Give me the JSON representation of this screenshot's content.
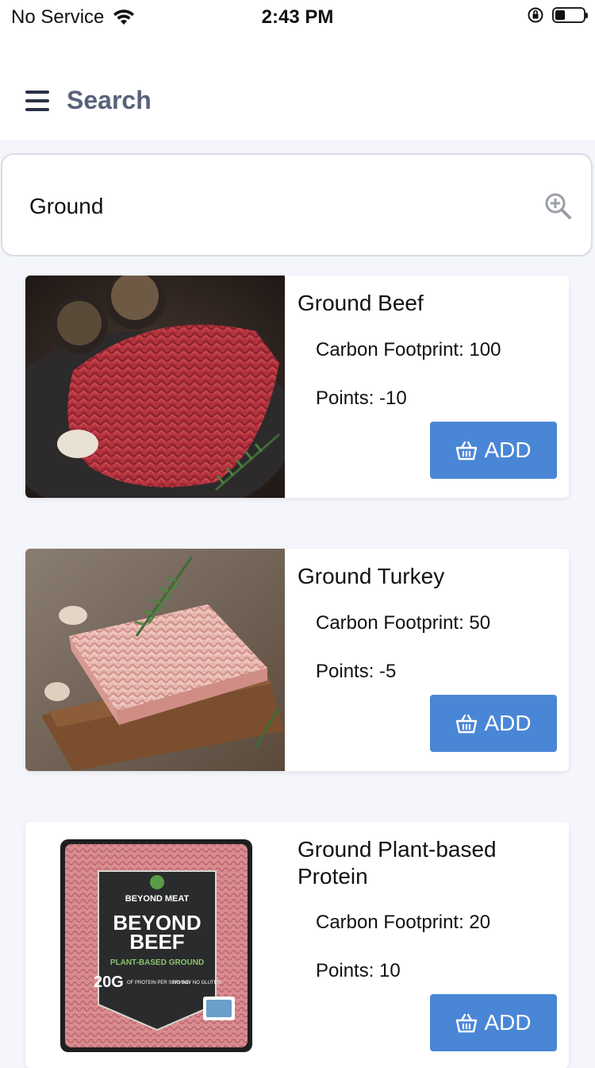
{
  "status_bar": {
    "carrier": "No Service",
    "time": "2:43 PM",
    "battery_level": 0.35
  },
  "header": {
    "title": "Search"
  },
  "search": {
    "value": "Ground"
  },
  "products": [
    {
      "name": "Ground Beef",
      "carbon": "Carbon Footprint: 100",
      "points": "Points: -10",
      "add_label": "ADD"
    },
    {
      "name": "Ground Turkey",
      "carbon": "Carbon Footprint: 50",
      "points": "Points: -5",
      "add_label": "ADD"
    },
    {
      "name": "Ground Plant-based Protein",
      "carbon": "Carbon Footprint: 20",
      "points": "Points: 10",
      "add_label": "ADD",
      "package_text": {
        "brand": "BEYOND MEAT",
        "product_line1": "BEYOND",
        "product_line2": "BEEF",
        "subtitle": "PLANT-BASED GROUND",
        "protein": "20G",
        "protein_detail": "OF PROTEIN PER SERVING",
        "claims": "NO SOY NO GLUTEN"
      }
    }
  ],
  "colors": {
    "accent": "#4a86d6",
    "title_text": "#58627a",
    "background": "#f4f6fb"
  },
  "icons": {
    "menu": "hamburger-icon",
    "search": "zoom-in-icon",
    "basket": "basket-icon",
    "wifi": "wifi-icon",
    "rotation_lock": "rotation-lock-icon",
    "battery": "battery-icon"
  }
}
